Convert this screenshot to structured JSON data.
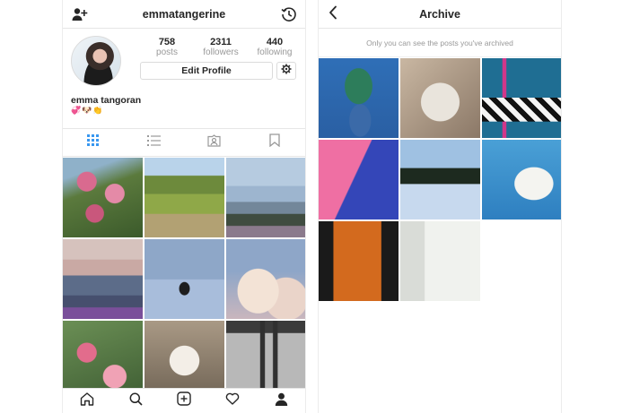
{
  "profile": {
    "username": "emmatangerine",
    "stats": [
      {
        "value": "758",
        "label": "posts"
      },
      {
        "value": "2311",
        "label": "followers"
      },
      {
        "value": "440",
        "label": "following"
      }
    ],
    "edit_label": "Edit Profile",
    "bio_name": "emma tangoran",
    "bio_emoji": "💞🐶👏",
    "tabs": [
      "grid-icon",
      "list-icon",
      "tagged-icon",
      "saved-icon"
    ],
    "active_tab": "grid-icon",
    "posts": [
      "pink-flowers-photo",
      "green-hillside-photo",
      "bay-view-photo",
      "ocean-sunset-photo",
      "palm-tree-photo",
      "clouds-photo",
      "protea-flowers-photo",
      "dog-photo",
      "pier-photo"
    ],
    "bottom_nav": [
      "home-icon",
      "search-icon",
      "new-post-icon",
      "activity-icon",
      "profile-icon"
    ]
  },
  "archive": {
    "title": "Archive",
    "note": "Only you can see the posts you've archived",
    "posts": [
      "monstera-leaf-photo",
      "food-plate-photo",
      "checkered-floor-photo",
      "pink-wall-photo",
      "lake-reflection-photo",
      "white-blossom-tree-photo",
      "orange-curtain-photo",
      "mirror-selfie-photo"
    ]
  },
  "colors": {
    "text": "#262626",
    "muted": "#999999",
    "border": "#dbdbdb",
    "active_tab": "#3897f0"
  }
}
